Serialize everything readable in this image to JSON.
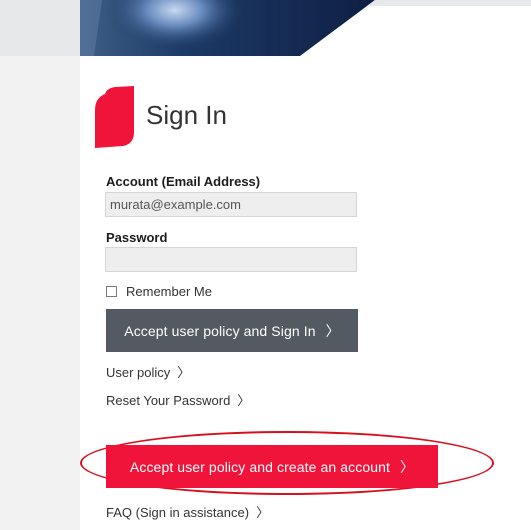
{
  "page": {
    "title": "Sign In"
  },
  "form": {
    "account_label": "Account (Email Address)",
    "account_value": "murata@example.com",
    "password_label": "Password",
    "password_value": "",
    "remember_label": "Remember Me",
    "remember_checked": false
  },
  "buttons": {
    "signin_label": "Accept user policy and Sign In",
    "create_label": "Accept user policy and create an account",
    "chevron": "〉"
  },
  "links": {
    "user_policy": "User policy",
    "reset_password": "Reset Your Password",
    "faq": "FAQ (Sign in assistance)"
  },
  "icons": {
    "logo": "red-parallelogram-logo",
    "chevron": "chevron-right-icon"
  },
  "colors": {
    "brand_red": "#f0143a",
    "signin_button": "#535a62",
    "highlight_ellipse": "#d8101e"
  }
}
